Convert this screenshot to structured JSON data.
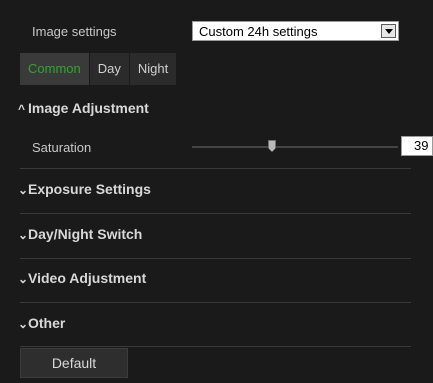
{
  "image_settings": {
    "label": "Image settings",
    "selected": "Custom 24h settings"
  },
  "tabs": [
    {
      "label": "Common",
      "active": true
    },
    {
      "label": "Day",
      "active": false
    },
    {
      "label": "Night",
      "active": false
    }
  ],
  "sections": [
    {
      "title": "Image Adjustment",
      "expanded": true
    },
    {
      "title": "Exposure Settings",
      "expanded": false
    },
    {
      "title": "Day/Night Switch",
      "expanded": false
    },
    {
      "title": "Video Adjustment",
      "expanded": false
    },
    {
      "title": "Other",
      "expanded": false
    }
  ],
  "saturation": {
    "label": "Saturation",
    "value": "39"
  },
  "default_button": "Default",
  "colors": {
    "active_tab_text": "#2ea82e",
    "background": "#1a1a1a"
  }
}
